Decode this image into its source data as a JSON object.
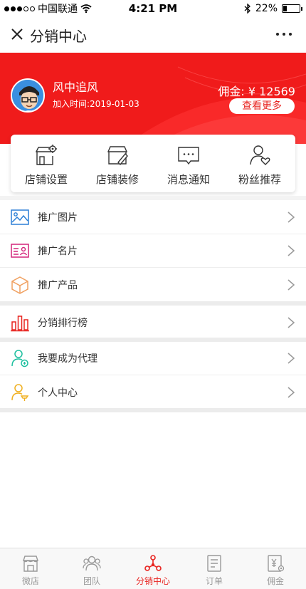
{
  "status": {
    "carrier": "中国联通",
    "time": "4:21 PM",
    "battery": "22%",
    "battery_level": 0.22
  },
  "nav": {
    "title": "分销中心"
  },
  "profile": {
    "name": "风中追风",
    "join_date": "加入时间:2019-01-03",
    "commission": "佣金: ¥ 12569",
    "view_more": "查看更多"
  },
  "shop_actions": [
    {
      "label": "店铺设置",
      "icon": "shop-settings-icon"
    },
    {
      "label": "店铺装修",
      "icon": "shop-decorate-icon"
    },
    {
      "label": "消息通知",
      "icon": "message-icon"
    },
    {
      "label": "粉丝推荐",
      "icon": "fans-icon"
    }
  ],
  "menu": {
    "promo": [
      {
        "label": "推广图片",
        "icon": "image-icon"
      },
      {
        "label": "推广名片",
        "icon": "card-icon"
      },
      {
        "label": "推广产品",
        "icon": "product-box-icon"
      }
    ],
    "ranking": [
      {
        "label": "分销排行榜",
        "icon": "bar-chart-icon"
      }
    ],
    "account": [
      {
        "label": "我要成为代理",
        "icon": "agent-icon"
      },
      {
        "label": "个人中心",
        "icon": "person-icon"
      }
    ]
  },
  "tabs": [
    {
      "label": "微店",
      "icon": "store-icon"
    },
    {
      "label": "团队",
      "icon": "team-icon"
    },
    {
      "label": "分销中心",
      "icon": "distribution-icon",
      "active": true
    },
    {
      "label": "订单",
      "icon": "order-icon"
    },
    {
      "label": "佣金",
      "icon": "commission-icon"
    }
  ],
  "colors": {
    "brand_red": "#e8231f",
    "hero_red": "#f01b1b"
  }
}
